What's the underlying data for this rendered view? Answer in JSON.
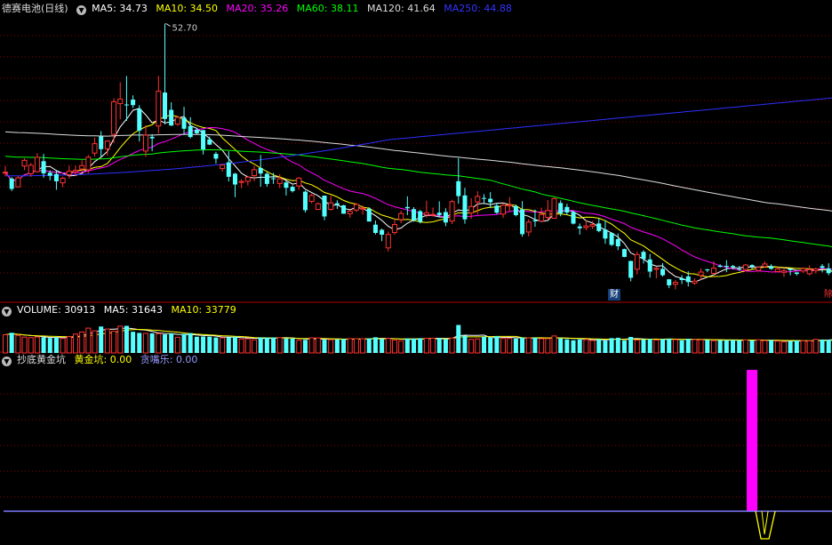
{
  "price_header": {
    "name": "德赛电池",
    "period": "(日线)",
    "ma5": {
      "label": "MA5:",
      "value": "34.73",
      "color": "#ffffff"
    },
    "ma10": {
      "label": "MA10:",
      "value": "34.50",
      "color": "#ffff00"
    },
    "ma20": {
      "label": "MA20:",
      "value": "35.26",
      "color": "#ff00ff"
    },
    "ma60": {
      "label": "MA60:",
      "value": "38.11",
      "color": "#00ff00"
    },
    "ma120": {
      "label": "MA120:",
      "value": "41.64",
      "color": "#dddddd"
    },
    "ma250": {
      "label": "MA250:",
      "value": "44.88",
      "color": "#3333ff"
    }
  },
  "volume_header": {
    "label": "VOLUME:",
    "value": "30913",
    "ma5": {
      "label": "MA5:",
      "value": "31643"
    },
    "ma10": {
      "label": "MA10:",
      "value": "33779"
    }
  },
  "indicator_header": {
    "name": "抄底黄金坑",
    "golden_pit": {
      "label": "黄金坑:",
      "value": "0.00"
    },
    "greedy": {
      "label": "贪嘴乐:",
      "value": "0.00"
    }
  },
  "annotations": {
    "high_label": "52.70",
    "finance_tag": "财",
    "right_tag": "除"
  },
  "icons": {
    "dropdown": "chevron-down-icon"
  },
  "colors": {
    "up": "#ff3232",
    "down": "#54ffff",
    "grid": "#8b0000",
    "panel_border": "#b00000",
    "ma5": "#ffffff",
    "ma10": "#ffff00",
    "ma20": "#ff00ff",
    "ma60": "#00ff00",
    "ma120": "#dddddd",
    "ma250": "#2f2fff",
    "pit_bar": "#ff00ff",
    "pit_line": "#7b7bff",
    "greedy": "#ffff00"
  },
  "chart_data": {
    "type": "candlestick",
    "price_range": [
      24.0,
      53.5
    ],
    "high_price": 52.7,
    "candles": [
      [
        36.88,
        36.89,
        36.46,
        37.54
      ],
      [
        36.21,
        35.11,
        34.88,
        36.36
      ],
      [
        35.33,
        36.29,
        35.26,
        36.5
      ],
      [
        37.54,
        38.15,
        37.11,
        38.37
      ],
      [
        36.72,
        37.63,
        36.4,
        37.87
      ],
      [
        36.95,
        38.48,
        36.85,
        38.91
      ],
      [
        38.06,
        36.76,
        36.3,
        38.84
      ],
      [
        36.84,
        36.51,
        36.02,
        37.08
      ],
      [
        36.69,
        35.92,
        35.02,
        37.14
      ],
      [
        35.76,
        36.25,
        35.3,
        36.41
      ],
      [
        36.62,
        36.99,
        36.21,
        37.59
      ],
      [
        36.95,
        37.09,
        36.52,
        37.59
      ],
      [
        37.23,
        37.59,
        36.82,
        38.14
      ],
      [
        37.15,
        38.48,
        36.79,
        38.71
      ],
      [
        38.92,
        39.92,
        38.57,
        40.57
      ],
      [
        40.69,
        39.34,
        38.49,
        41.26
      ],
      [
        39.38,
        40.2,
        38.67,
        40.3
      ],
      [
        40.91,
        44.38,
        40.0,
        44.75
      ],
      [
        44.18,
        44.67,
        42.51,
        46.45
      ],
      [
        44.09,
        44.06,
        42.34,
        47.12
      ],
      [
        44.61,
        44.02,
        43.72,
        45.06
      ],
      [
        43.62,
        41.32,
        40.16,
        44.02
      ],
      [
        39.14,
        40.83,
        38.51,
        41.88
      ],
      [
        40.65,
        40.49,
        39.12,
        40.94
      ],
      [
        41.8,
        45.5,
        40.99,
        47.13
      ],
      [
        45.36,
        42.55,
        41.96,
        52.7
      ],
      [
        43.52,
        41.85,
        41.81,
        44.33
      ],
      [
        42.0,
        42.72,
        41.81,
        42.87
      ],
      [
        42.68,
        41.51,
        40.86,
        43.84
      ],
      [
        41.8,
        40.63,
        40.48,
        42.74
      ],
      [
        41.4,
        41.03,
        40.93,
        41.62
      ],
      [
        41.36,
        39.32,
        38.77,
        41.39
      ],
      [
        40.38,
        39.82,
        39.77,
        40.68
      ],
      [
        38.84,
        38.33,
        37.8,
        39.06
      ],
      [
        37.28,
        37.65,
        36.95,
        37.72
      ],
      [
        37.94,
        36.4,
        35.9,
        39.11
      ],
      [
        36.73,
        35.58,
        34.23,
        36.82
      ],
      [
        35.8,
        35.91,
        35.2,
        36.14
      ],
      [
        35.92,
        36.36,
        35.47,
        36.53
      ],
      [
        36.53,
        37.15,
        35.91,
        37.58
      ],
      [
        37.34,
        36.75,
        35.34,
        38.72
      ],
      [
        36.72,
        35.64,
        35.34,
        36.9
      ],
      [
        36.24,
        36.17,
        35.64,
        36.82
      ],
      [
        35.69,
        36.18,
        35.2,
        36.69
      ],
      [
        35.8,
        35.23,
        34.41,
        35.96
      ],
      [
        35.33,
        34.88,
        34.73,
        35.49
      ],
      [
        35.42,
        36.26,
        35.02,
        36.37
      ],
      [
        34.82,
        32.85,
        32.6,
        34.93
      ],
      [
        33.79,
        34.41,
        33.56,
        34.61
      ],
      [
        32.93,
        33.53,
        32.92,
        33.68
      ],
      [
        34.4,
        32.18,
        31.78,
        34.4
      ],
      [
        32.93,
        33.63,
        32.81,
        34.38
      ],
      [
        33.59,
        33.42,
        32.98,
        33.91
      ],
      [
        33.37,
        32.47,
        32.48,
        33.42
      ],
      [
        32.47,
        32.75,
        32.05,
        32.87
      ],
      [
        32.86,
        33.46,
        32.65,
        33.61
      ],
      [
        33.0,
        33.06,
        32.38,
        33.35
      ],
      [
        33.0,
        31.64,
        31.68,
        33.16
      ],
      [
        31.31,
        30.43,
        30.27,
        31.75
      ],
      [
        30.76,
        30.24,
        29.56,
        30.89
      ],
      [
        28.84,
        30.26,
        28.47,
        30.58
      ],
      [
        30.47,
        31.33,
        30.24,
        31.95
      ],
      [
        31.85,
        32.49,
        31.46,
        32.79
      ],
      [
        33.19,
        33.05,
        32.32,
        34.32
      ],
      [
        32.96,
        31.77,
        31.62,
        33.18
      ],
      [
        32.74,
        31.61,
        31.44,
        32.87
      ],
      [
        32.36,
        32.57,
        32.07,
        33.86
      ],
      [
        32.38,
        32.4,
        32.18,
        33.13
      ],
      [
        32.58,
        32.33,
        32.07,
        33.79
      ],
      [
        32.65,
        31.54,
        31.14,
        33.05
      ],
      [
        31.69,
        33.76,
        31.38,
        33.96
      ],
      [
        35.93,
        34.35,
        33.54,
        38.39
      ],
      [
        34.42,
        31.88,
        31.41,
        35.23
      ],
      [
        32.56,
        33.24,
        31.93,
        34.13
      ],
      [
        33.73,
        34.31,
        32.4,
        34.87
      ],
      [
        34.15,
        34.12,
        33.51,
        34.55
      ],
      [
        34.06,
        33.69,
        33.09,
        34.77
      ],
      [
        33.34,
        32.58,
        32.44,
        33.62
      ],
      [
        32.43,
        33.37,
        32.02,
        33.6
      ],
      [
        33.31,
        33.42,
        32.67,
        34.25
      ],
      [
        33.27,
        32.32,
        32.19,
        33.45
      ],
      [
        32.94,
        30.3,
        30.03,
        33.82
      ],
      [
        30.53,
        31.58,
        30.06,
        31.88
      ],
      [
        31.78,
        31.66,
        31.08,
        32.92
      ],
      [
        31.69,
        32.39,
        31.62,
        33.11
      ],
      [
        32.07,
        32.82,
        31.8,
        33.93
      ],
      [
        31.99,
        34.08,
        31.94,
        34.18
      ],
      [
        33.61,
        32.51,
        32.2,
        33.89
      ],
      [
        33.19,
        32.6,
        32.34,
        33.53
      ],
      [
        32.64,
        31.42,
        31.33,
        32.79
      ],
      [
        31.12,
        30.92,
        30.25,
        31.43
      ],
      [
        31.0,
        31.17,
        30.73,
        31.78
      ],
      [
        31.15,
        31.32,
        30.86,
        31.7
      ],
      [
        31.44,
        30.63,
        30.5,
        31.94
      ],
      [
        30.78,
        29.83,
        29.27,
        31.79
      ],
      [
        30.42,
        29.16,
        29.04,
        30.51
      ],
      [
        29.77,
        29.01,
        28.6,
        30.38
      ],
      [
        28.71,
        27.88,
        27.84,
        28.75
      ],
      [
        27.45,
        25.66,
        25.28,
        27.48
      ],
      [
        26.57,
        28.13,
        26.02,
        28.42
      ],
      [
        28.42,
        27.66,
        27.18,
        28.6
      ],
      [
        27.61,
        26.32,
        25.68,
        28.19
      ],
      [
        26.56,
        26.68,
        25.6,
        26.81
      ],
      [
        26.61,
        25.93,
        25.78,
        27.22
      ],
      [
        25.5,
        24.86,
        24.56,
        25.53
      ],
      [
        24.96,
        25.17,
        24.42,
        25.42
      ],
      [
        25.61,
        25.42,
        24.99,
        25.93
      ],
      [
        25.8,
        25.2,
        24.74,
        26.35
      ],
      [
        25.1,
        25.3,
        24.9,
        25.6
      ],
      [
        25.91,
        26.27,
        25.43,
        26.66
      ],
      [
        26.56,
        26.45,
        26.26,
        26.6
      ],
      [
        26.13,
        26.68,
        25.98,
        27.41
      ],
      [
        26.95,
        26.82,
        26.76,
        27.09
      ],
      [
        26.93,
        26.82,
        26.26,
        27.53
      ],
      [
        26.92,
        26.79,
        26.56,
        27.03
      ],
      [
        26.63,
        26.56,
        26.39,
        26.91
      ],
      [
        26.55,
        27.02,
        26.34,
        27.13
      ],
      [
        27.01,
        26.83,
        26.6,
        27.1
      ],
      [
        26.44,
        26.78,
        26.42,
        26.82
      ],
      [
        26.85,
        27.13,
        26.72,
        27.41
      ],
      [
        26.88,
        26.61,
        26.52,
        27.1
      ],
      [
        26.32,
        26.6,
        26.29,
        26.79
      ],
      [
        26.25,
        26.4,
        25.74,
        26.73
      ],
      [
        26.61,
        26.47,
        25.93,
        26.63
      ],
      [
        26.23,
        26.07,
        25.91,
        26.25
      ],
      [
        26.38,
        26.63,
        26.18,
        26.75
      ],
      [
        26.09,
        26.53,
        25.91,
        26.99
      ],
      [
        26.41,
        26.6,
        26.11,
        26.74
      ],
      [
        26.9,
        26.72,
        26.24,
        27.12
      ],
      [
        26.66,
        26.15,
        25.93,
        27.2
      ],
      [
        26.03,
        24.78,
        24.74,
        26.4
      ],
      [
        24.91,
        24.24,
        23.87,
        25.13
      ]
    ],
    "volume_range": [
      0,
      60000
    ],
    "volume": [
      35130,
      38970,
      33900,
      30590,
      29500,
      30810,
      30180,
      28930,
      29730,
      27890,
      31500,
      36470,
      40480,
      47900,
      42740,
      50990,
      46080,
      41820,
      51700,
      52350,
      40910,
      38710,
      37850,
      37910,
      37270,
      35890,
      37620,
      30290,
      36830,
      38300,
      31260,
      31740,
      31600,
      29800,
      29300,
      30100,
      31400,
      26900,
      27400,
      25300,
      29900,
      29800,
      30000,
      29600,
      27900,
      27900,
      24500,
      25200,
      29200,
      28900,
      25600,
      25400,
      25900,
      26900,
      27600,
      27500,
      27400,
      28100,
      30300,
      27200,
      28000,
      24700,
      23600,
      28000,
      27800,
      28500,
      28400,
      28500,
      28500,
      26900,
      28800,
      54000,
      33400,
      26300,
      27100,
      31300,
      29900,
      32500,
      28000,
      28000,
      27900,
      29500,
      29000,
      29600,
      27400,
      27500,
      32800,
      28000,
      26300,
      24500,
      26000,
      25800,
      24200,
      26600,
      24000,
      28600,
      29300,
      24300,
      30900,
      24800,
      26000,
      26800,
      25000,
      26700,
      27500,
      25600,
      24300,
      27300,
      25900,
      25300,
      25300,
      23700,
      24200,
      24800,
      25000,
      24400,
      25200,
      24200,
      25400,
      23900,
      24800,
      22900,
      21600,
      22800,
      24100,
      23500,
      23300,
      26300,
      25900,
      25800,
      28100,
      30913
    ],
    "golden_pit": {
      "label": "黄金坑",
      "index": 117,
      "value": 1.0,
      "current": 0.0
    },
    "greedy": {
      "label": "贪嘴乐",
      "index": 117,
      "current": 0.0
    },
    "ma_latest": {
      "MA5": 34.73,
      "MA10": 34.5,
      "MA20": 35.26,
      "MA60": 38.11,
      "MA120": 41.64,
      "MA250": 44.88
    },
    "volume_latest": {
      "VOLUME": 30913,
      "MA5": 31643,
      "MA10": 33779
    }
  }
}
